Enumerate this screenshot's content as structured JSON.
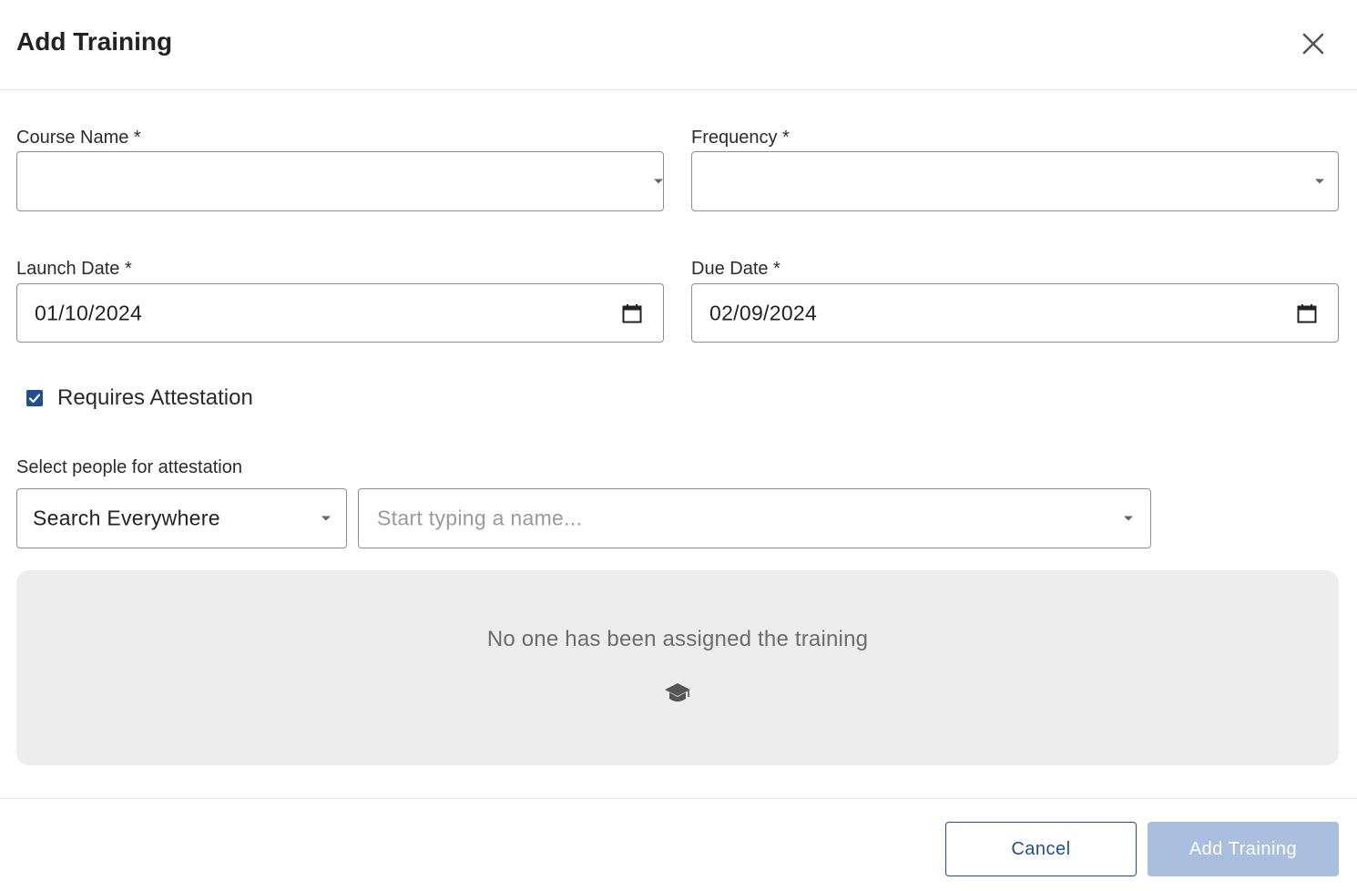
{
  "dialog": {
    "title": "Add Training",
    "close_icon": "close-icon"
  },
  "form": {
    "course_name": {
      "label": "Course Name *",
      "value": ""
    },
    "frequency": {
      "label": "Frequency *",
      "value": ""
    },
    "launch_date": {
      "label": "Launch Date *",
      "value": "01/10/2024"
    },
    "due_date": {
      "label": "Due Date *",
      "value": "02/09/2024"
    },
    "requires_attestation": {
      "label": "Requires Attestation",
      "checked": true
    },
    "people": {
      "label": "Select people for attestation",
      "scope_value": "Search Everywhere",
      "name_placeholder": "Start typing a name..."
    }
  },
  "assignees": {
    "empty_message": "No one has been assigned the training",
    "empty_icon": "graduation-cap-icon"
  },
  "footer": {
    "cancel_label": "Cancel",
    "submit_label": "Add Training"
  },
  "colors": {
    "primary": "#1e4f93",
    "primary_disabled": "#a9bfdd",
    "empty_bg": "#ededed"
  }
}
